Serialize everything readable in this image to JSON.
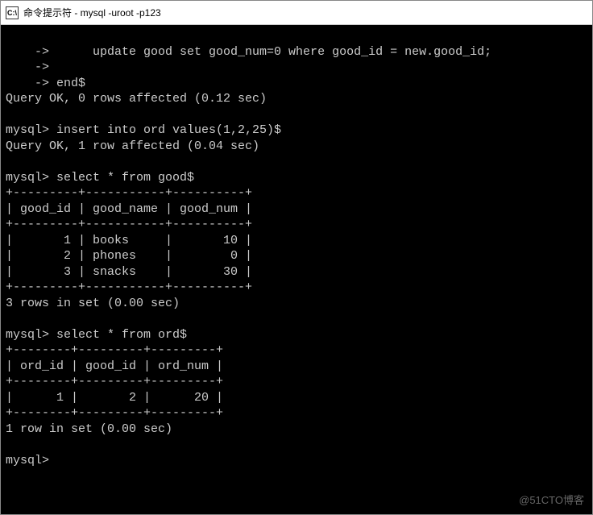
{
  "window": {
    "title": "命令提示符 - mysql  -uroot -p123",
    "icon_label": "C:\\"
  },
  "terminal": {
    "lines": [
      "    ->      update good set good_num=0 where good_id = new.good_id;",
      "    ->",
      "    -> end$",
      "Query OK, 0 rows affected (0.12 sec)",
      "",
      "mysql> insert into ord values(1,2,25)$",
      "Query OK, 1 row affected (0.04 sec)",
      "",
      "mysql> select * from good$",
      "+---------+-----------+----------+",
      "| good_id | good_name | good_num |",
      "+---------+-----------+----------+",
      "|       1 | books     |       10 |",
      "|       2 | phones    |        0 |",
      "|       3 | snacks    |       30 |",
      "+---------+-----------+----------+",
      "3 rows in set (0.00 sec)",
      "",
      "mysql> select * from ord$",
      "+--------+---------+---------+",
      "| ord_id | good_id | ord_num |",
      "+--------+---------+---------+",
      "|      1 |       2 |      20 |",
      "+--------+---------+---------+",
      "1 row in set (0.00 sec)",
      "",
      "mysql>"
    ]
  },
  "watermark": "@51CTO博客",
  "chart_data": [
    {
      "type": "table",
      "name": "good",
      "columns": [
        "good_id",
        "good_name",
        "good_num"
      ],
      "rows": [
        [
          1,
          "books",
          10
        ],
        [
          2,
          "phones",
          0
        ],
        [
          3,
          "snacks",
          30
        ]
      ]
    },
    {
      "type": "table",
      "name": "ord",
      "columns": [
        "ord_id",
        "good_id",
        "ord_num"
      ],
      "rows": [
        [
          1,
          2,
          20
        ]
      ]
    }
  ]
}
